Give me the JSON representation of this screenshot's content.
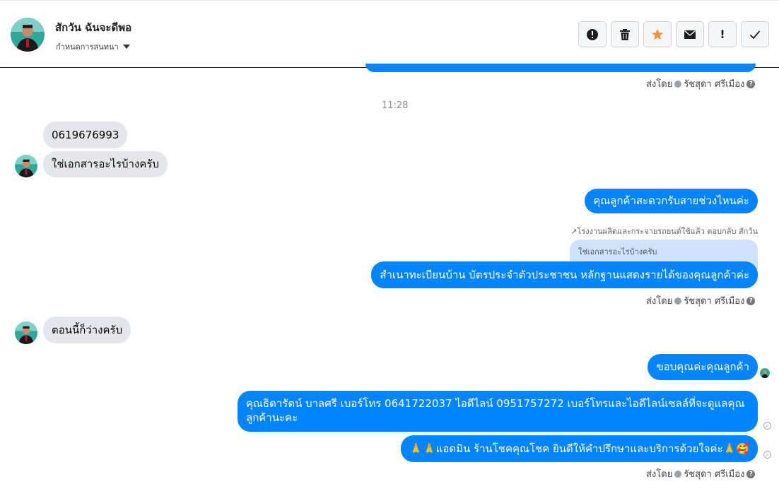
{
  "header": {
    "contact_name": "สักวัน ฉันจะดีพอ",
    "subtitle": "กำหนดการสนทนา",
    "avatar_icon": "profile-photo",
    "toolbar": [
      {
        "icon": "alert-circle-icon"
      },
      {
        "icon": "trash-icon"
      },
      {
        "icon": "star-icon",
        "color": "#f7923a"
      },
      {
        "icon": "mail-icon"
      },
      {
        "icon": "exclamation-icon",
        "label": "!"
      },
      {
        "icon": "check-icon"
      }
    ]
  },
  "sent_by": {
    "prefix": "ส่งโดย",
    "agent": "รัชสุดา ศรีเมือง",
    "help": "?"
  },
  "timestamp": "11:28",
  "messages": {
    "in1": "0619676993",
    "in2": "ใช่เอกสารอะไรบ้างครับ",
    "out1": "คุณลูกค้าสะดวกรับสายช่วงไหนค่ะ",
    "reply_note": "↗โรงงานผลิตและกระจายรถยนต์ใช้แล้ว ตอบกลับ สักวัน",
    "quote": "ใช่เอกสารอะไรบ้างครับ",
    "out2": "สำเนาทะเบียนบ้าน บัตรประจำตัวประชาชน หลักฐานแสดงรายได้ของคุณลูกค้าค่ะ",
    "in3": "ตอนนี้ก็ว่างครับ",
    "out3": "ขอบคุณค่ะคุณลูกค้า",
    "out4_line1": "คุณธิดารัตน์ บาลศรี เบอร์โทร 0641722037  ไอดีไลน์ 0951757272   เบอร์โทรและไอดีไลน์เซลล์ที่จะดูแลคุณ",
    "out4_line2": "ลูกค้านะคะ",
    "out5": "🙏🙏แอดมิน ร้านโชคคุณโชค ยินดีให้คำปรึกษาและบริการด้วยใจค่ะ🙏🥰"
  },
  "colors": {
    "outgoing": "#0084ff",
    "incoming": "#e4e6eb",
    "star": "#f7923a"
  }
}
